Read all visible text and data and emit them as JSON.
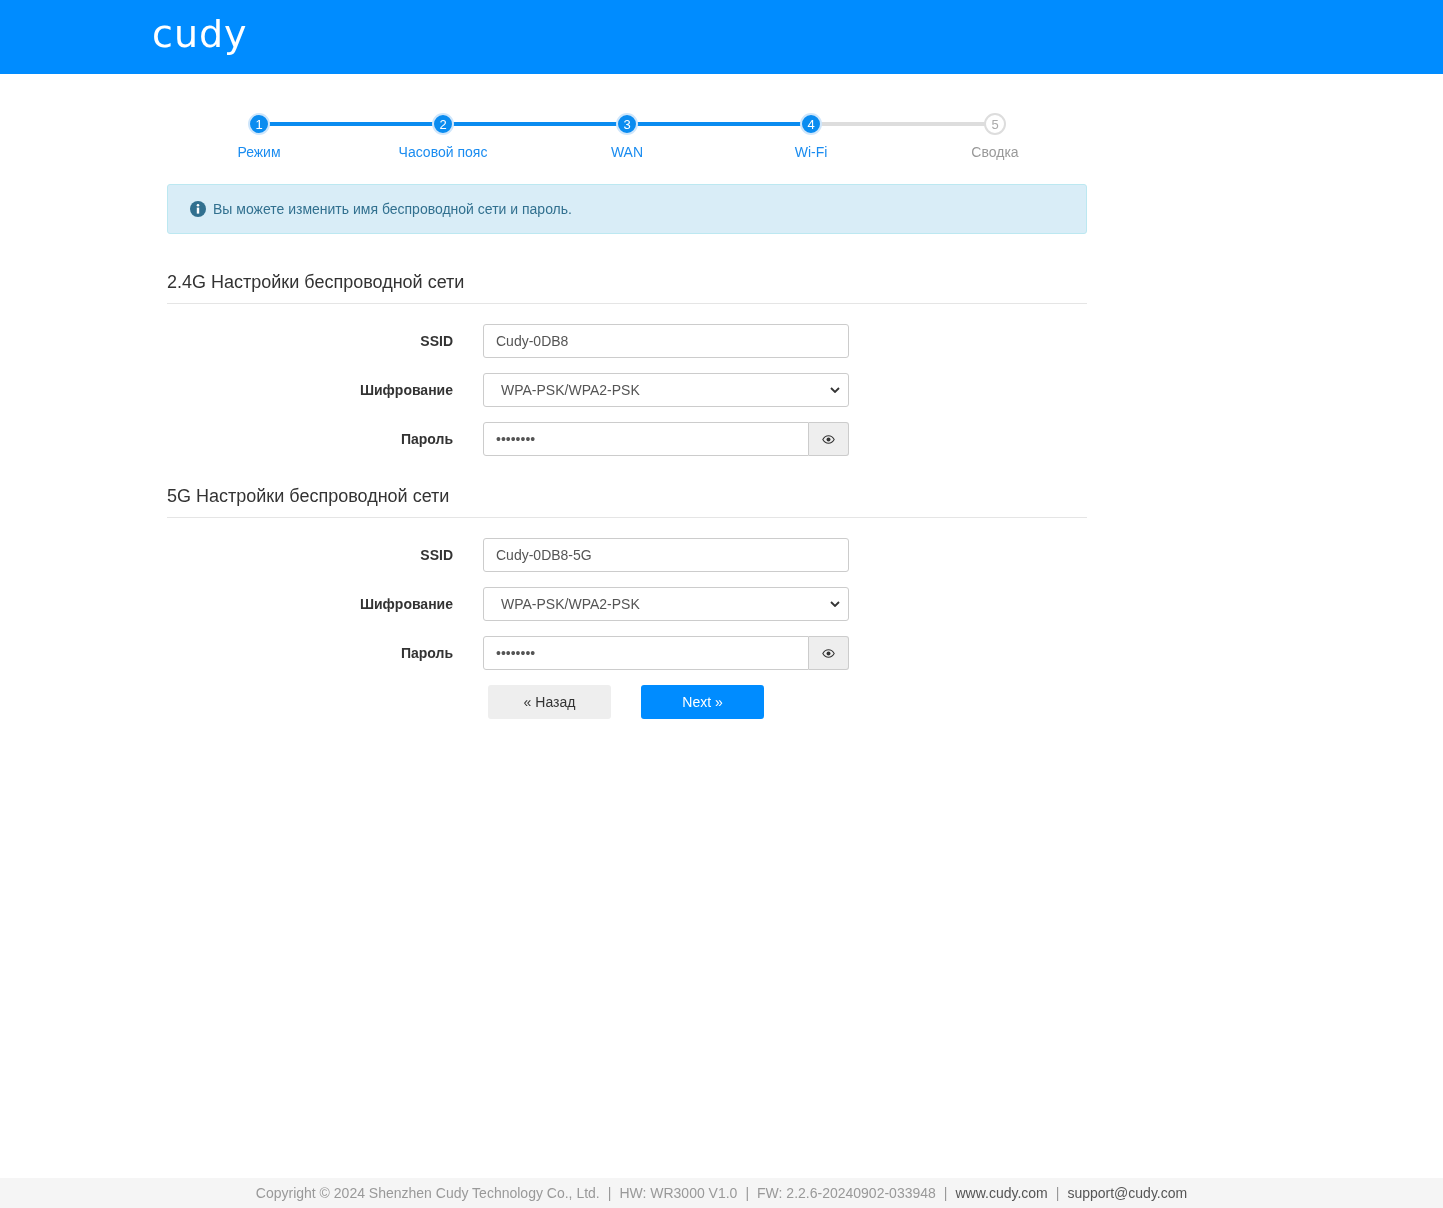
{
  "header": {
    "logo": "cudy"
  },
  "steps": [
    {
      "number": "1",
      "label": "Режим",
      "done": true
    },
    {
      "number": "2",
      "label": "Часовой пояс",
      "done": true
    },
    {
      "number": "3",
      "label": "WAN",
      "done": true
    },
    {
      "number": "4",
      "label": "Wi-Fi",
      "done": true
    },
    {
      "number": "5",
      "label": "Сводка",
      "done": false
    }
  ],
  "info": "Вы можете изменить имя беспроводной сети и пароль.",
  "sections": [
    {
      "title": "2.4G Настройки беспроводной сети",
      "fields": [
        {
          "kind": "text",
          "label": "SSID",
          "value": "Cudy-0DB8"
        },
        {
          "kind": "select",
          "label": "Шифрование",
          "value": "WPA-PSK/WPA2-PSK"
        },
        {
          "kind": "password",
          "label": "Пароль",
          "value": "••••••••"
        }
      ]
    },
    {
      "title": "5G Настройки беспроводной сети",
      "fields": [
        {
          "kind": "text",
          "label": "SSID",
          "value": "Cudy-0DB8-5G"
        },
        {
          "kind": "select",
          "label": "Шифрование",
          "value": "WPA-PSK/WPA2-PSK"
        },
        {
          "kind": "password",
          "label": "Пароль",
          "value": "••••••••"
        }
      ]
    }
  ],
  "buttons": [
    {
      "label": "« Назад",
      "kind": "secondary"
    },
    {
      "label": "Next »",
      "kind": "primary"
    }
  ],
  "footer": [
    {
      "text": "Copyright © 2024 Shenzhen Cudy Technology Co., Ltd.",
      "kind": "muted"
    },
    {
      "text": "|",
      "kind": "separator"
    },
    {
      "text": "HW: WR3000 V1.0",
      "kind": "muted"
    },
    {
      "text": "|",
      "kind": "separator"
    },
    {
      "text": "FW: 2.2.6-20240902-033948",
      "kind": "muted"
    },
    {
      "text": "|",
      "kind": "separator"
    },
    {
      "text": "www.cudy.com",
      "kind": "link"
    },
    {
      "text": "|",
      "kind": "separator"
    },
    {
      "text": "support@cudy.com",
      "kind": "link"
    }
  ]
}
